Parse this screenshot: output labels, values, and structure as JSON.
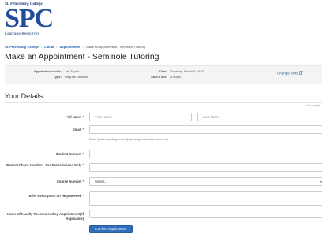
{
  "logo": {
    "top": "St. Petersburg College",
    "main": "SPC",
    "sub": "Learning Resources"
  },
  "breadcrumb": [
    "St. Petersburg College",
    "LibCal",
    "Appointments",
    "Make an Appointment - Seminole Tutoring"
  ],
  "page_title": "Make an Appointment - Seminole Tutoring",
  "appointment": {
    "with_label": "Appointment with:",
    "with_value": "Jeff Taylor",
    "type_label": "Type:",
    "type_value": "Regular Session",
    "date_label": "Date:",
    "date_value": "Tuesday, March 5, 2019",
    "start_label": "Start Time:",
    "start_value": "2:00pm",
    "change_time": "Change Time"
  },
  "section_title": "Your Details",
  "required_note": "* is require",
  "form": {
    "full_name_label": "Full Name",
    "first_name_placeholder": "First Name",
    "last_name_placeholder": "Last Name",
    "email_label": "Email",
    "email_help": "Enter @live.spcollege.edu, @spcollege.edu addresses only",
    "student_number_label": "Student Number",
    "phone_label": "Student Phone Number - For Cancellations Only",
    "course_label": "Course Number",
    "course_selected": "Select...",
    "description_label": "Brief Description on Help Needed",
    "faculty_label": "Name of Faculty Recommending Appointment (If Applicable)",
    "required_mark": "*"
  },
  "confirm_button": "Confirm Appointment"
}
